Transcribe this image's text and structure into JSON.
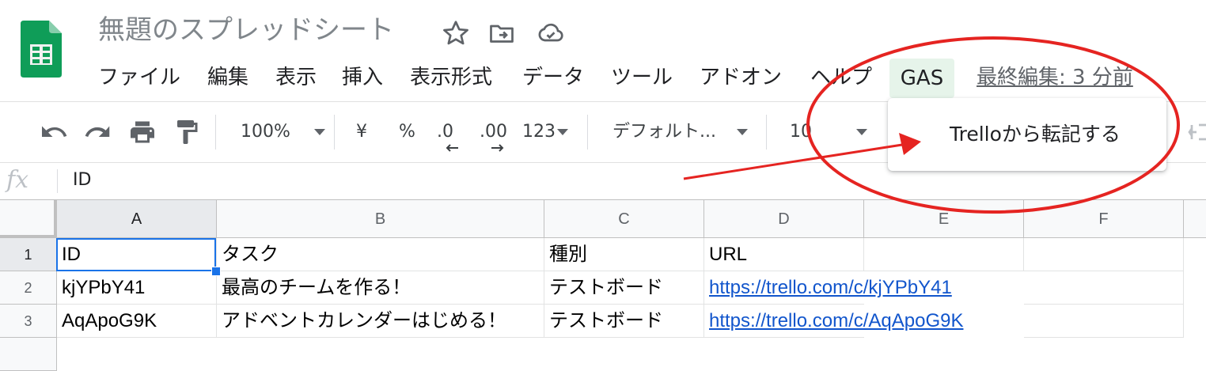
{
  "header": {
    "title": "無題のスプレッドシート",
    "last_edit": "最終編集: 3 分前"
  },
  "menu": {
    "items": [
      "ファイル",
      "編集",
      "表示",
      "挿入",
      "表示形式",
      "データ",
      "ツール",
      "アドオン",
      "ヘルプ"
    ],
    "gas": "GAS"
  },
  "dropdown": {
    "item": "Trelloから転記する"
  },
  "toolbar": {
    "zoom": "100%",
    "currency": "¥",
    "percent": "%",
    "decimal_decrease": ".0",
    "decimal_increase": ".00",
    "more_formats": "123",
    "font": "デフォルト...",
    "font_size": "10"
  },
  "formula_bar": {
    "label": "fx",
    "value": "ID"
  },
  "grid": {
    "columns": [
      "A",
      "B",
      "C",
      "D",
      "E",
      "F"
    ],
    "rows": [
      "1",
      "2",
      "3"
    ],
    "cells": [
      [
        "ID",
        "タスク",
        "種別",
        "URL",
        "",
        ""
      ],
      [
        "kjYPbY41",
        "最高のチームを作る！",
        "テストボード",
        "https://trello.com/c/kjYPbY41",
        "",
        ""
      ],
      [
        "AqApoG9K",
        "アドベントカレンダーはじめる！",
        "テストボード",
        "https://trello.com/c/AqApoG9K",
        "",
        ""
      ]
    ]
  },
  "colors": {
    "accent": "#1a73e8",
    "sheets_green": "#0f9d58",
    "annotation_red": "#e52421",
    "link": "#1155cc"
  }
}
